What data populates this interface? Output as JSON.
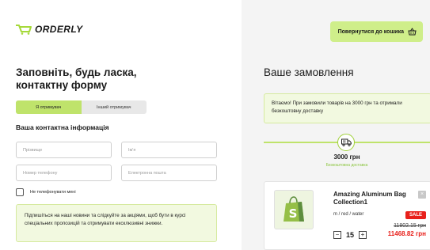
{
  "header": {
    "logo_text": "ORDERLY",
    "back_button": "Повернутися до кошика"
  },
  "form": {
    "title": "Заповніть, будь ласка, контактну форму",
    "recipient_tabs": [
      "Я отримувач",
      "Інший отримувач"
    ],
    "active_tab": "Я отримувач",
    "section_heading": "Ваша контактна інформація",
    "placeholders": {
      "surname": "Прізвище",
      "name": "Ім'я",
      "phone": "Номер телефону",
      "email": "Електронна пошта"
    },
    "no_call_label": "Не телефонувати мені",
    "subscribe_text": "Підпишіться на наші новини та слідкуйте за акціями, щоб бути в курсі спеціальних пропозицій та отримувати ексклюзивні знижки."
  },
  "order": {
    "heading": "Ваше замовлення",
    "gift_text": "Вітаємо! При замовили товарів на 3000 грн та отримали безкоштовну доставку",
    "threshold": "3000 грн",
    "threshold_sub": "Безкоштовна доставка",
    "product": {
      "name": "Amazing Aluminum Bag Collection1",
      "variant": "m / red / water",
      "badge": "SALE",
      "quantity": "15",
      "old_price": "11802.15 грн",
      "new_price": "11468.82 грн"
    }
  },
  "colors": {
    "accent": "#cfee8a",
    "accent_dark": "#bfe36b",
    "sale": "#e8201b"
  }
}
